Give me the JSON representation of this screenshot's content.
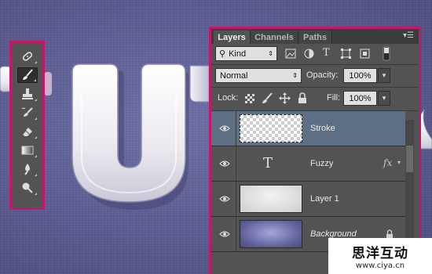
{
  "colors": {
    "highlight_border": "#c2186b",
    "panel_bg": "#535353",
    "selected_row": "#5d6f84",
    "canvas": "#5b5c92"
  },
  "tools": [
    {
      "icon": "spot-healing-brush-icon"
    },
    {
      "icon": "brush-icon",
      "active": true
    },
    {
      "icon": "clone-stamp-icon"
    },
    {
      "icon": "history-brush-icon"
    },
    {
      "icon": "eraser-icon"
    },
    {
      "icon": "gradient-icon"
    },
    {
      "icon": "blur-icon"
    },
    {
      "icon": "dodge-icon"
    }
  ],
  "layers_panel": {
    "tabs": [
      "Layers",
      "Channels",
      "Paths"
    ],
    "filter": {
      "label": "Kind"
    },
    "blend_mode": "Normal",
    "opacity_label": "Opacity:",
    "opacity_value": "100%",
    "lock_label": "Lock:",
    "fill_label": "Fill:",
    "fill_value": "100%",
    "layers": [
      {
        "name": "Stroke",
        "type": "transparent",
        "selected": true
      },
      {
        "name": "Fuzzy",
        "type": "text",
        "fx": "fx"
      },
      {
        "name": "Layer 1",
        "type": "texture"
      },
      {
        "name": "Background",
        "type": "background",
        "italic": true
      }
    ]
  },
  "watermark": {
    "line1": "思洋互动",
    "line2": "www.ciya.cn"
  }
}
